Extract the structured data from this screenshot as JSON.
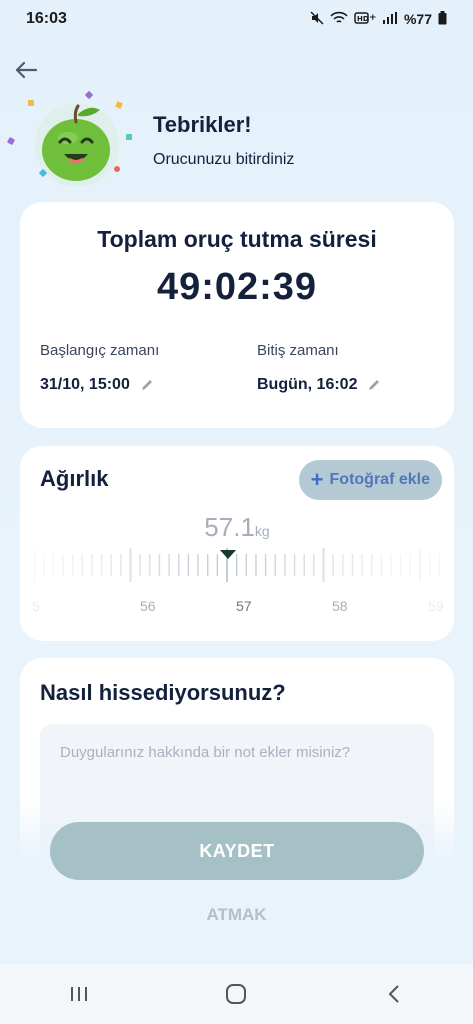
{
  "status_bar": {
    "time": "16:03",
    "battery": "%77",
    "icons": [
      "mute-icon",
      "wifi-icon",
      "hd-icon",
      "signal-icon",
      "battery-icon"
    ]
  },
  "header": {
    "title": "Tebrikler!",
    "subtitle": "Orucunuzu bitirdiniz",
    "apple_color": "#6fbf3a"
  },
  "duration": {
    "label": "Toplam oruç tutma süresi",
    "value": "49:02:39",
    "start_label": "Başlangıç zamanı",
    "start_value": "31/10, 15:00",
    "end_label": "Bitiş zamanı",
    "end_value": "Bugün, 16:02"
  },
  "weight": {
    "title": "Ağırlık",
    "photo_button": "Fotoğraf ekle",
    "value": "57.1",
    "unit": "kg",
    "ruler_labels": [
      "5",
      "56",
      "57",
      "58",
      "59"
    ]
  },
  "feeling": {
    "title": "Nasıl hissediyorsunuz?",
    "placeholder": "Duygularınız hakkında bir not ekler misiniz?"
  },
  "actions": {
    "save": "KAYDET",
    "discard": "ATMAK"
  },
  "colors": {
    "accent": "#14213d",
    "save_button": "#a6c1c6",
    "photo_button": "#b5c9d4"
  }
}
